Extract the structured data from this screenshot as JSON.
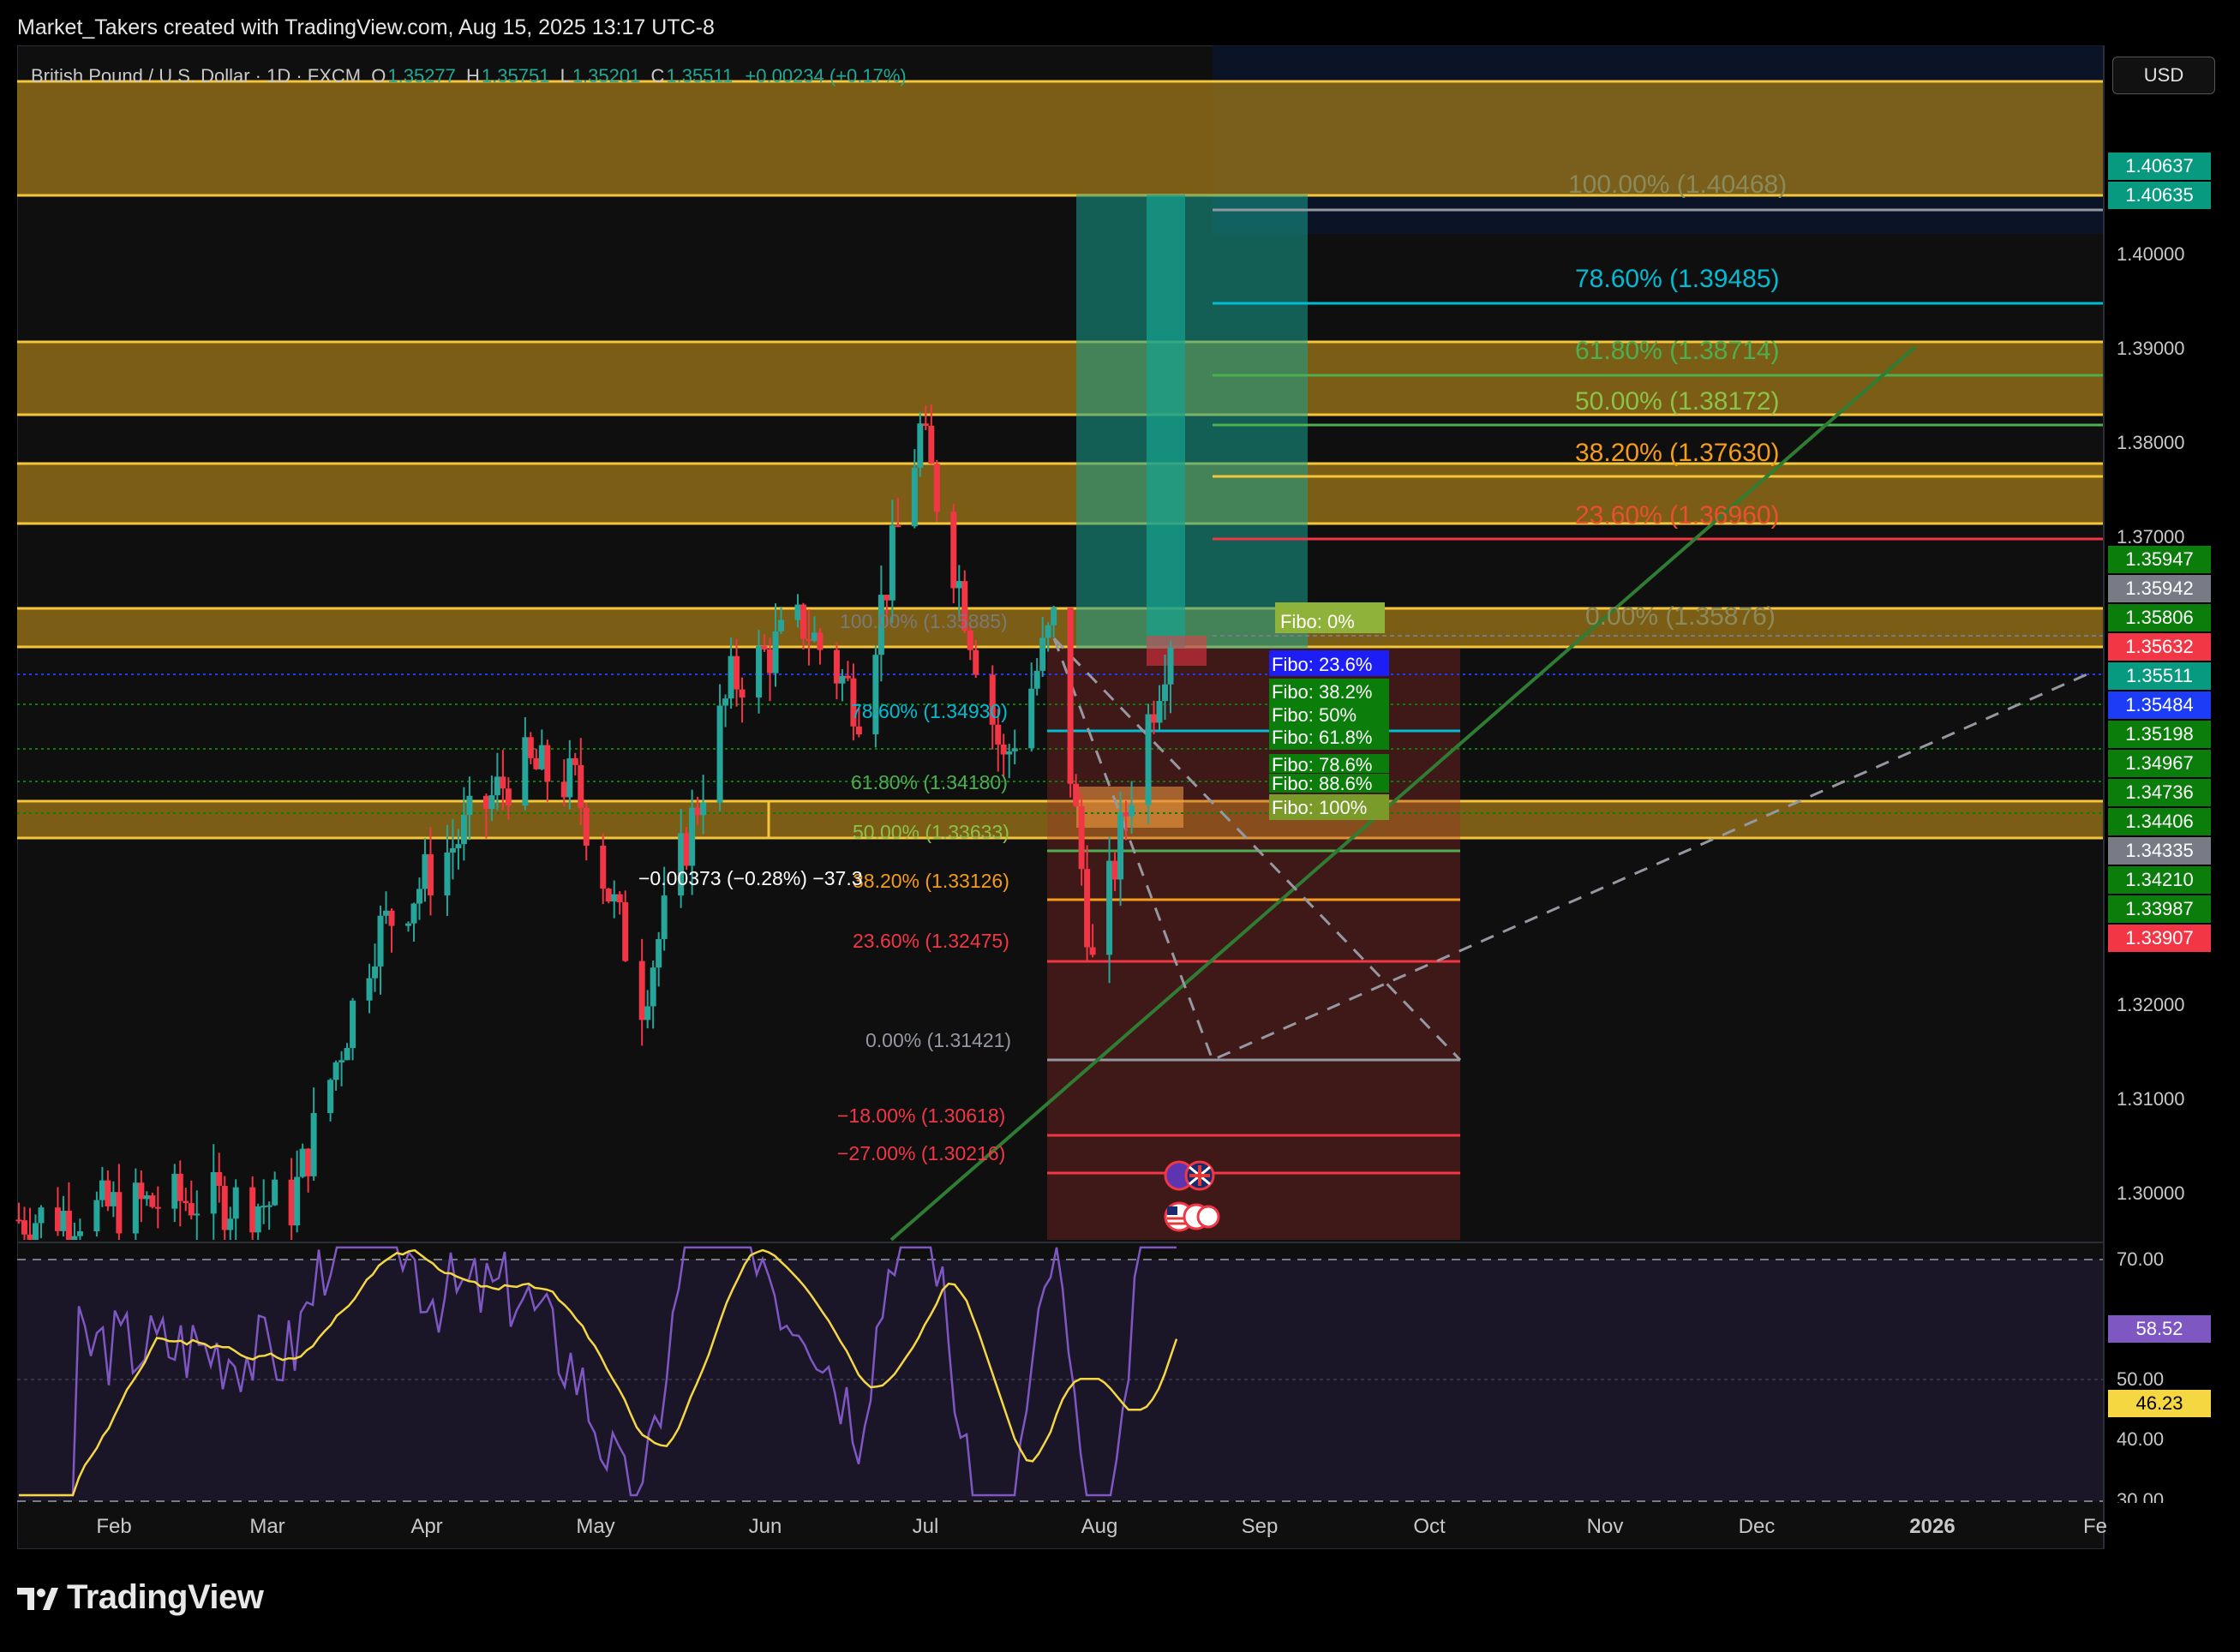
{
  "header": {
    "attribution": "Market_Takers created with TradingView.com, Aug 15, 2025 13:17 UTC-8"
  },
  "legend": {
    "symbol": "British Pound / U.S. Dollar · 1D · FXCM",
    "open_label": "O",
    "open": "1.35277",
    "high_label": "H",
    "high": "1.35751",
    "low_label": "L",
    "low": "1.35201",
    "close_label": "C",
    "close": "1.35511",
    "change": "+0.00234 (+0.17%)"
  },
  "currency_button": "USD",
  "price_axis": [
    "1.40000",
    "1.39000",
    "1.38000",
    "1.37000",
    "1.32000",
    "1.31000",
    "1.30000"
  ],
  "rsi_axis": [
    "70.00",
    "50.00",
    "40.00",
    "30.00"
  ],
  "time_axis": [
    "Feb",
    "Mar",
    "Apr",
    "May",
    "Jun",
    "Jul",
    "Aug",
    "Sep",
    "Oct",
    "Nov",
    "Dec",
    "2026",
    "Fe"
  ],
  "price_tags": [
    {
      "text": "1.40637",
      "bg": "#089981"
    },
    {
      "text": "1.40635",
      "bg": "#089981"
    },
    {
      "text": "1.35947",
      "bg": "#0a7d0a"
    },
    {
      "text": "1.35942",
      "bg": "#787b86"
    },
    {
      "text": "1.35806",
      "bg": "#0a7d0a"
    },
    {
      "text": "1.35632",
      "bg": "#f23645"
    },
    {
      "text": "1.35511",
      "bg": "#089981"
    },
    {
      "text": "1.35484",
      "bg": "#1d3cf5"
    },
    {
      "text": "1.35198",
      "bg": "#0a7d0a"
    },
    {
      "text": "1.34967",
      "bg": "#0a7d0a"
    },
    {
      "text": "1.34736",
      "bg": "#0a7d0a"
    },
    {
      "text": "1.34406",
      "bg": "#0a7d0a"
    },
    {
      "text": "1.34335",
      "bg": "#787b86"
    },
    {
      "text": "1.34210",
      "bg": "#0a7d0a"
    },
    {
      "text": "1.33987",
      "bg": "#0a7d0a"
    },
    {
      "text": "1.33907",
      "bg": "#f23645"
    }
  ],
  "rsi_tags": [
    {
      "text": "58.52",
      "bg": "#7e57c2",
      "fg": "#ffffff"
    },
    {
      "text": "46.23",
      "bg": "#f5d742",
      "fg": "#000000"
    }
  ],
  "annotations": {
    "fib_upper": [
      "100.00% (1.40468)",
      "78.60% (1.39485)",
      "61.80% (1.38714)",
      "50.00% (1.38172)",
      "38.20% (1.37630)",
      "23.60% (1.36960)",
      "0.00% (1.35876)"
    ],
    "fib_lower": [
      "100.00% (1.35885)",
      "78.60% (1.34930)",
      "61.80% (1.34180)",
      "50.00% (1.33633)",
      "38.20% (1.33126)",
      "23.60% (1.32475)",
      "0.00% (1.31421)",
      "−18.00% (1.30618)",
      "−27.00% (1.30216)"
    ],
    "fibo_boxes": [
      "Fibo:   0%",
      "Fibo: 23.6%",
      "Fibo: 38.2%",
      "Fibo:   50%",
      "Fibo: 61.8%",
      "Fibo: 78.6%",
      "Fibo: 88.6%",
      "Fibo:  100%"
    ],
    "measure": "−0.00373 (−0.28%) −37.3"
  },
  "colors": {
    "up": "#26a69a",
    "down": "#f23645",
    "zone": "#f5c53a",
    "rsi": "#7e57c2",
    "rsi_ma": "#f5d742"
  },
  "chart_data": {
    "type": "candlestick",
    "title": "British Pound / U.S. Dollar · 1D · FXCM",
    "ylim": [
      1.295,
      1.4115
    ],
    "last_close": 1.35511,
    "support_resistance_zones": [
      [
        1.3985,
        1.4105
      ],
      [
        1.3828,
        1.3905
      ],
      [
        1.3715,
        1.3782
      ],
      [
        1.3562,
        1.3604
      ],
      [
        1.3435,
        1.3472
      ]
    ],
    "trend_line": [
      [
        "2025-07-16",
        1.2955
      ],
      [
        "2025-12-05",
        1.39
      ]
    ],
    "rsi": {
      "length": 14,
      "current": 58.52,
      "ma_current": 46.23,
      "levels": [
        70,
        50,
        30
      ]
    },
    "price_path": [
      [
        "2025-01-20",
        1.297
      ],
      [
        "2025-02-20",
        1.299
      ],
      [
        "2025-03-10",
        1.2985
      ],
      [
        "2025-03-25",
        1.325
      ],
      [
        "2025-04-05",
        1.332
      ],
      [
        "2025-04-20",
        1.342
      ],
      [
        "2025-04-30",
        1.34
      ],
      [
        "2025-05-12",
        1.319
      ],
      [
        "2025-05-28",
        1.35
      ],
      [
        "2025-06-10",
        1.356
      ],
      [
        "2025-06-20",
        1.348
      ],
      [
        "2025-07-01",
        1.375
      ],
      [
        "2025-07-08",
        1.36
      ],
      [
        "2025-07-16",
        1.342
      ],
      [
        "2025-07-25",
        1.356
      ],
      [
        "2025-08-01",
        1.322
      ],
      [
        "2025-08-08",
        1.34
      ],
      [
        "2025-08-15",
        1.3551
      ]
    ]
  }
}
